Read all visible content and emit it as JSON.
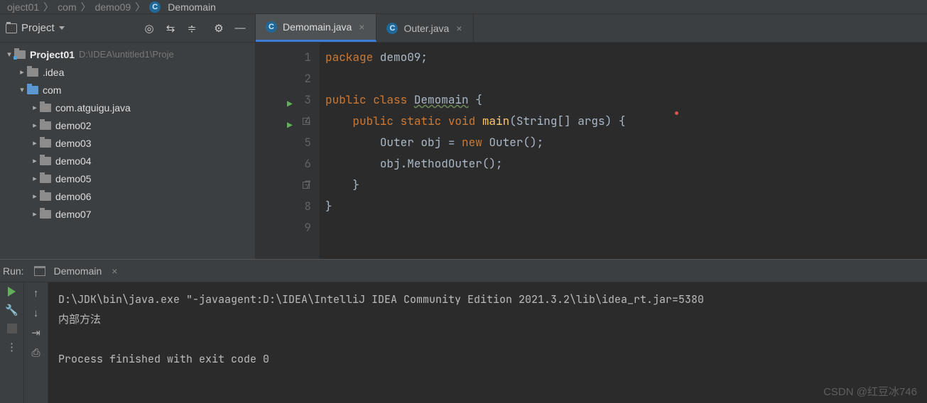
{
  "breadcrumb": {
    "p1": "oject01",
    "sep": "〉",
    "p2": "com",
    "p3": "demo09",
    "p4": "Demomain"
  },
  "sidebar": {
    "title": "Project",
    "root_name": "Project01",
    "root_path": "D:\\IDEA\\untitled1\\Proje",
    "items": [
      {
        "name": ".idea"
      },
      {
        "name": "com"
      },
      {
        "name": "com.atguigu.java"
      },
      {
        "name": "demo02"
      },
      {
        "name": "demo03"
      },
      {
        "name": "demo04"
      },
      {
        "name": "demo05"
      },
      {
        "name": "demo06"
      },
      {
        "name": "demo07"
      }
    ]
  },
  "tabs": [
    {
      "label": "Demomain.java",
      "icon": "C"
    },
    {
      "label": "Outer.java",
      "icon": "C"
    }
  ],
  "code": {
    "lines": [
      "1",
      "2",
      "3",
      "4",
      "5",
      "6",
      "7",
      "8",
      "9"
    ],
    "kw_package": "package",
    "pkg_name": " demo09;",
    "kw_public": "public",
    "kw_class": " class ",
    "cls_name": "Demomain",
    "brace_open": " {",
    "kw_public2": "public",
    "kw_static": " static",
    "kw_void": " void ",
    "fn_main": "main",
    "params": "(String[] args) {",
    "line5": "Outer obj = ",
    "kw_new": "new",
    "line5b": " Outer();",
    "line6": "obj.MethodOuter();",
    "brace_close": "}",
    "brace_close2": "}"
  },
  "run": {
    "label": "Run:",
    "tab": "Demomain",
    "out1": "D:\\JDK\\bin\\java.exe \"-javaagent:D:\\IDEA\\IntelliJ IDEA Community Edition 2021.3.2\\lib\\idea_rt.jar=5380",
    "out2": "内部方法",
    "out3": "Process finished with exit code 0"
  },
  "watermark": "CSDN @红豆冰746"
}
